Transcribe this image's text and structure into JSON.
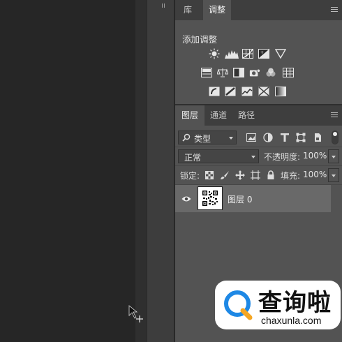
{
  "adjustments_panel": {
    "tabs": [
      {
        "label": "库",
        "active": false
      },
      {
        "label": "调整",
        "active": true
      }
    ],
    "hint_text": "添加调整",
    "icons_row1": [
      "brightness-contrast-icon",
      "levels-icon",
      "curves-icon",
      "exposure-icon",
      "vibrance-icon"
    ],
    "icons_row2": [
      "hue-saturation-icon",
      "color-balance-icon",
      "black-white-icon",
      "photo-filter-icon",
      "channel-mixer-icon",
      "color-lookup-icon"
    ],
    "icons_row3": [
      "invert-icon",
      "posterize-icon",
      "threshold-icon",
      "selective-color-icon",
      "gradient-map-icon"
    ]
  },
  "layers_panel": {
    "tabs": [
      {
        "label": "图层",
        "active": true
      },
      {
        "label": "通道",
        "active": false
      },
      {
        "label": "路径",
        "active": false
      }
    ],
    "filter_kind": "类型",
    "blend_mode": "正常",
    "opacity_label": "不透明度:",
    "opacity_value": "100%",
    "lock_label": "锁定:",
    "fill_label": "填充:",
    "fill_value": "100%",
    "layers": [
      {
        "name": "图层 0",
        "visible": true
      }
    ]
  },
  "watermark": {
    "brand": "查询啦",
    "domain": "chaxunla.com",
    "brand_color": "#1e88e5"
  },
  "colors": {
    "panel_bg": "#535353",
    "tab_bar_bg": "#3e3e3e",
    "canvas_bg": "#262626",
    "selected_layer_bg": "#696969"
  }
}
